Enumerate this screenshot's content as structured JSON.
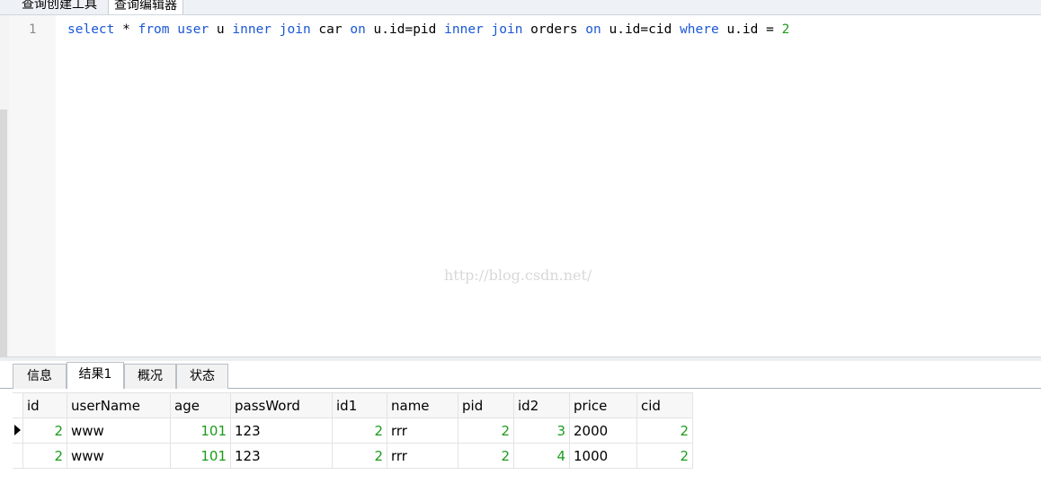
{
  "top_tabs": {
    "builder": "查询创建工具",
    "editor": "查询编辑器"
  },
  "editor": {
    "line_number": "1",
    "tokens": [
      {
        "t": "select",
        "k": true
      },
      {
        "t": " * ",
        "k": false
      },
      {
        "t": "from",
        "k": true
      },
      {
        "t": " ",
        "k": false
      },
      {
        "t": "user",
        "k": true
      },
      {
        "t": " u ",
        "k": false
      },
      {
        "t": "inner",
        "k": true
      },
      {
        "t": " ",
        "k": false
      },
      {
        "t": "join",
        "k": true
      },
      {
        "t": " car ",
        "k": false
      },
      {
        "t": "on",
        "k": true
      },
      {
        "t": " u.id=pid ",
        "k": false
      },
      {
        "t": "inner",
        "k": true
      },
      {
        "t": " ",
        "k": false
      },
      {
        "t": "join",
        "k": true
      },
      {
        "t": " orders ",
        "k": false
      },
      {
        "t": "on",
        "k": true
      },
      {
        "t": " u.id=cid ",
        "k": false
      },
      {
        "t": "where",
        "k": true
      },
      {
        "t": " u.id = ",
        "k": false
      },
      {
        "t": "2",
        "n": true
      }
    ],
    "watermark": "http://blog.csdn.net/"
  },
  "result_tabs": [
    "信息",
    "结果1",
    "概况",
    "状态"
  ],
  "active_result_tab": 1,
  "grid": {
    "columns": [
      "id",
      "userName",
      "age",
      "passWord",
      "id1",
      "name",
      "pid",
      "id2",
      "price",
      "cid"
    ],
    "rows": [
      [
        "2",
        "www",
        "101",
        "123",
        "2",
        "rrr",
        "2",
        "3",
        "2000",
        "2"
      ],
      [
        "2",
        "www",
        "101",
        "123",
        "2",
        "rrr",
        "2",
        "4",
        "1000",
        "2"
      ]
    ],
    "current_row": 0
  }
}
